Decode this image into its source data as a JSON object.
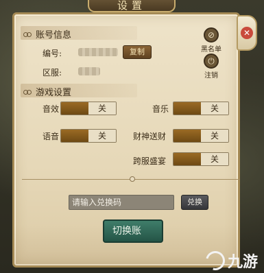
{
  "dialog": {
    "title": "设置"
  },
  "account": {
    "section_title": "账号信息",
    "id_label": "编号:",
    "server_label": "区服:",
    "copy_label": "复制",
    "blacklist_label": "黑名单",
    "logout_label": "注销"
  },
  "game_settings": {
    "section_title": "游戏设置",
    "toggles": [
      {
        "label": "音效",
        "state": "关"
      },
      {
        "label": "音乐",
        "state": "关"
      },
      {
        "label": "语音",
        "state": "关"
      },
      {
        "label": "财神送财",
        "state": "关"
      },
      {
        "label": "跨服盛宴",
        "state": "关"
      }
    ]
  },
  "redeem": {
    "placeholder": "请输入兑换码",
    "button_label": "兑换"
  },
  "switch_account": {
    "label": "切换账"
  },
  "watermark": {
    "text": "九游"
  }
}
